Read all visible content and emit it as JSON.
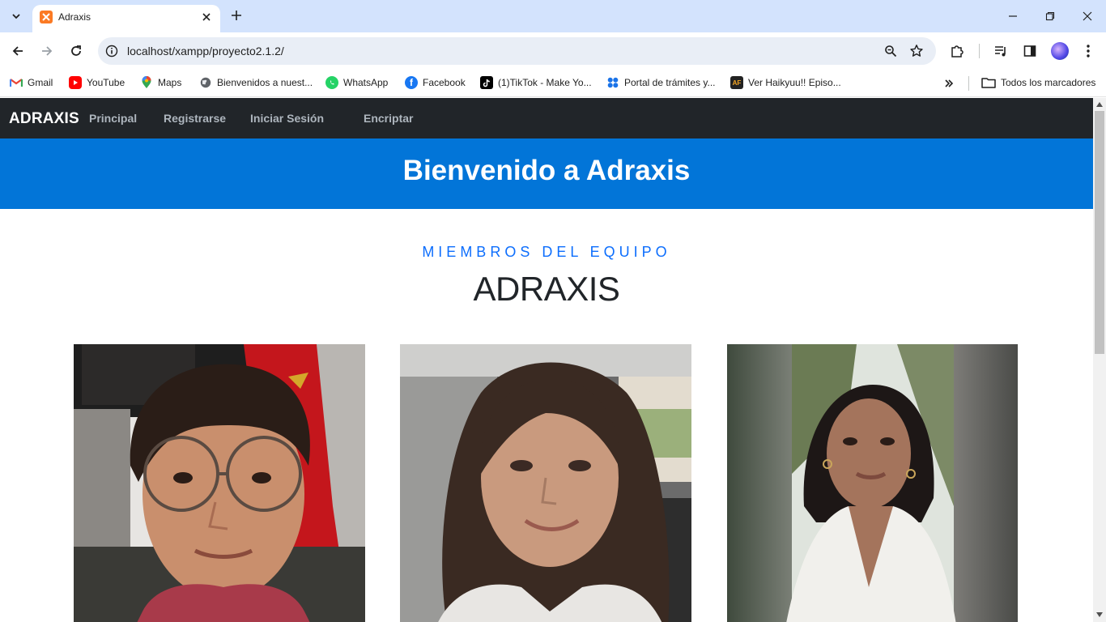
{
  "browser": {
    "tab_title": "Adraxis",
    "url": "localhost/xampp/proyecto2.1.2/",
    "bookmarks": [
      {
        "label": "Gmail",
        "icon": "gmail-icon",
        "color": "#ea4335"
      },
      {
        "label": "YouTube",
        "icon": "youtube-icon",
        "color": "#ff0000"
      },
      {
        "label": "Maps",
        "icon": "maps-icon",
        "color": "#34a853"
      },
      {
        "label": "Bienvenidos a nuest...",
        "icon": "globe-icon",
        "color": "#5f6368"
      },
      {
        "label": "WhatsApp",
        "icon": "whatsapp-icon",
        "color": "#25d366"
      },
      {
        "label": "Facebook",
        "icon": "facebook-icon",
        "color": "#1877f2"
      },
      {
        "label": "(1)TikTok - Make Yo...",
        "icon": "tiktok-icon",
        "color": "#000000"
      },
      {
        "label": "Portal de trámites y...",
        "icon": "portal-icon",
        "color": "#1a73e8"
      },
      {
        "label": "Ver Haikyuu!! Episo...",
        "icon": "animeflv-icon",
        "color": "#222222"
      }
    ],
    "all_bookmarks_label": "Todos los marcadores"
  },
  "site": {
    "brand": "ADRAXIS",
    "nav": [
      "Principal",
      "Registrarse",
      "Iniciar Sesión",
      "Encriptar"
    ],
    "hero_title": "Bienvenido a Adraxis",
    "section_kicker": "MIEMBROS DEL EQUIPO",
    "section_title": "ADRAXIS"
  },
  "colors": {
    "navbar": "#212529",
    "hero": "#0275d8",
    "kicker": "#0d6efd"
  }
}
